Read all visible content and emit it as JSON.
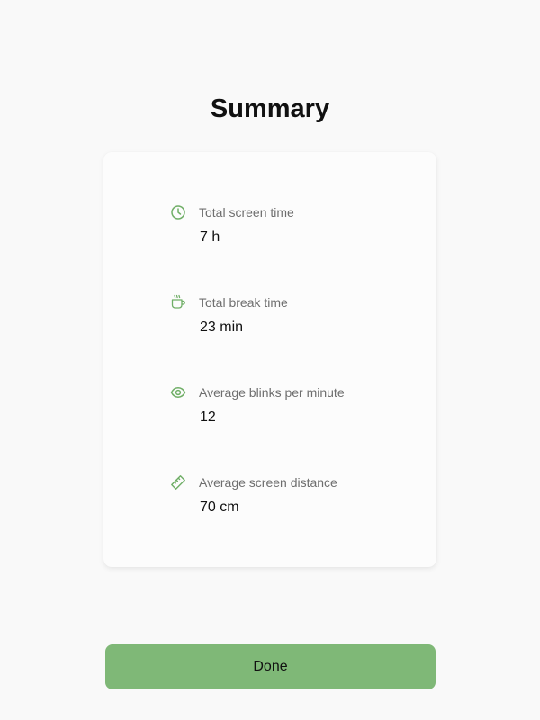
{
  "page": {
    "title": "Summary"
  },
  "stats": [
    {
      "icon": "clock-icon",
      "label": "Total screen time",
      "value": "7 h"
    },
    {
      "icon": "coffee-cup-icon",
      "label": "Total break time",
      "value": "23 min"
    },
    {
      "icon": "eye-icon",
      "label": "Average blinks per minute",
      "value": "12"
    },
    {
      "icon": "ruler-icon",
      "label": "Average screen distance",
      "value": "70 cm"
    }
  ],
  "actions": {
    "done_label": "Done"
  },
  "colors": {
    "accent": "#7fb877",
    "icon": "#6fae66",
    "background": "#f9f9f9",
    "card": "#fcfcfc"
  }
}
